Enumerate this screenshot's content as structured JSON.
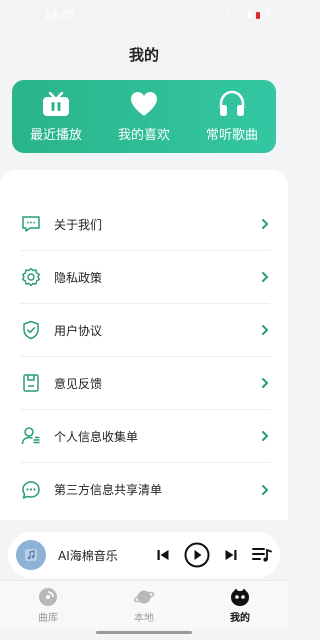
{
  "status_bar": {
    "time": "14:07",
    "battery": "5"
  },
  "page": {
    "title": "我的"
  },
  "quick_actions": [
    {
      "label": "最近播放",
      "icon": "tv-icon"
    },
    {
      "label": "我的喜欢",
      "icon": "heart-icon"
    },
    {
      "label": "常听歌曲",
      "icon": "headphones-icon"
    }
  ],
  "menu": [
    {
      "label": "关于我们",
      "icon": "chat-bubble-icon"
    },
    {
      "label": "隐私政策",
      "icon": "gear-icon"
    },
    {
      "label": "用户协议",
      "icon": "shield-check-icon"
    },
    {
      "label": "意见反馈",
      "icon": "feedback-box-icon"
    },
    {
      "label": "个人信息收集单",
      "icon": "user-list-icon"
    },
    {
      "label": "第三方信息共享清单",
      "icon": "chat-dots-icon"
    }
  ],
  "player": {
    "title": "AI海棉音乐"
  },
  "tabs": [
    {
      "label": "曲库",
      "active": false
    },
    {
      "label": "本地",
      "active": false
    },
    {
      "label": "我的",
      "active": true
    }
  ],
  "colors": {
    "accent": "#2ab48a",
    "accent_end": "#33c7a3",
    "icon_green": "#2a9d6f"
  }
}
